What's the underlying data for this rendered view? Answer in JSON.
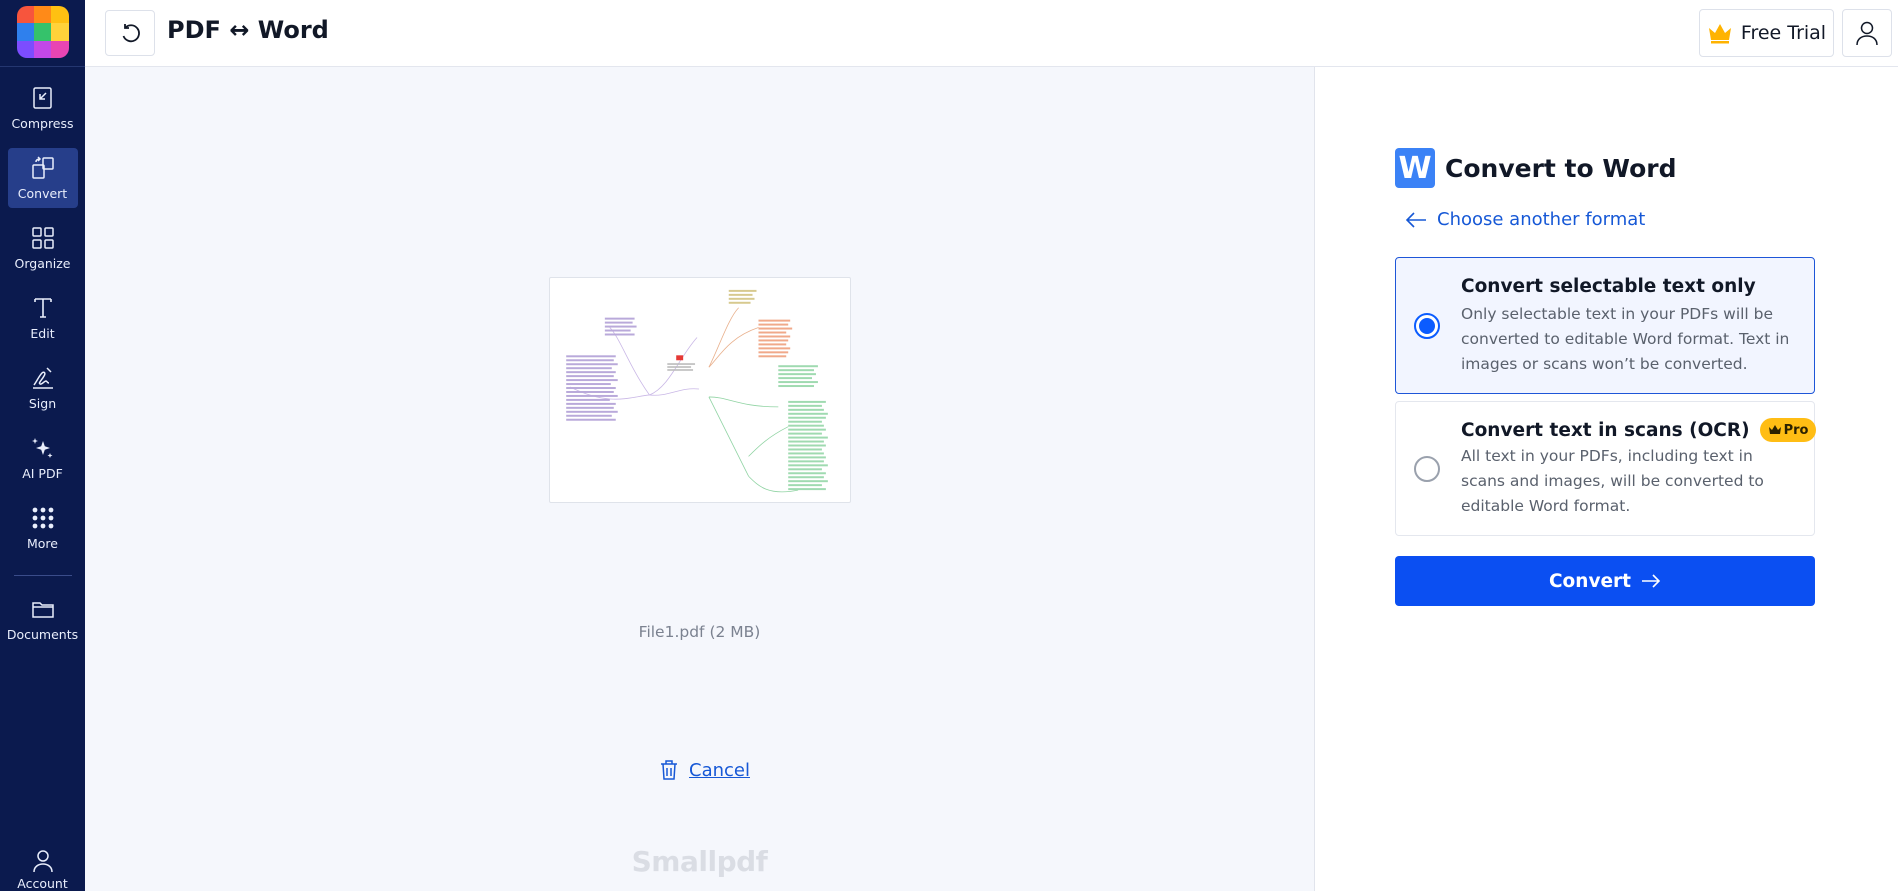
{
  "app": {
    "title": "PDF ↔ Word",
    "free_trial_label": "Free Trial"
  },
  "sidebar": {
    "items": [
      {
        "label": "Compress",
        "icon": "compress-icon",
        "active": false
      },
      {
        "label": "Convert",
        "icon": "convert-icon",
        "active": true
      },
      {
        "label": "Organize",
        "icon": "organize-icon",
        "active": false
      },
      {
        "label": "Edit",
        "icon": "edit-icon",
        "active": false
      },
      {
        "label": "Sign",
        "icon": "sign-icon",
        "active": false
      },
      {
        "label": "AI PDF",
        "icon": "sparkles-icon",
        "active": false
      },
      {
        "label": "More",
        "icon": "grid-dots-icon",
        "active": false
      },
      {
        "label": "Documents",
        "icon": "folder-icon",
        "active": false
      }
    ],
    "account_label": "Account"
  },
  "preview": {
    "file_name": "File1.pdf (2 MB)",
    "cancel_label": "Cancel",
    "wordmark": "Smallpdf"
  },
  "panel": {
    "title": "Convert to Word",
    "word_icon_letter": "W",
    "choose_label": "Choose another format",
    "options": [
      {
        "title": "Convert selectable text only",
        "description": "Only selectable text in your PDFs will be converted to editable Word format. Text in images or scans won’t be converted.",
        "selected": true
      },
      {
        "title": "Convert text in scans (OCR)",
        "badge": "Pro",
        "description": "All text in your PDFs, including text in scans and images, will be converted to editable Word format.",
        "selected": false
      }
    ],
    "convert_label": "Convert"
  },
  "colors": {
    "sidebar_bg": "#0b1a4e",
    "sidebar_active": "#263e8a",
    "accent": "#0b4ff2",
    "link": "#1658d6",
    "pro_badge": "#ffbd14",
    "word_icon": "#3b82f6"
  }
}
